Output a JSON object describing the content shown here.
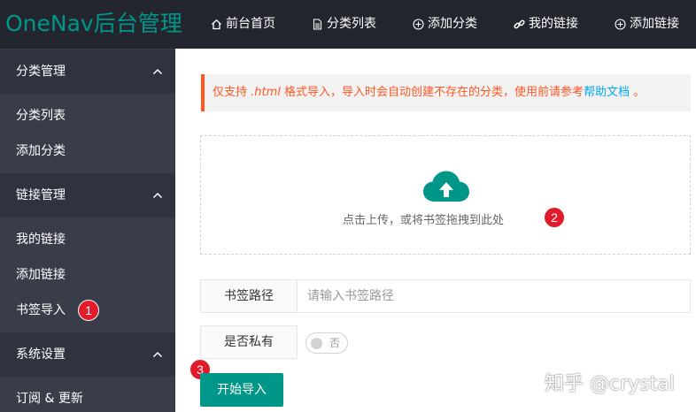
{
  "app": {
    "title": "OneNav后台管理"
  },
  "topnav": [
    {
      "label": "前台首页",
      "icon": "home-icon"
    },
    {
      "label": "分类列表",
      "icon": "document-icon"
    },
    {
      "label": "添加分类",
      "icon": "plus-circle-icon"
    },
    {
      "label": "我的链接",
      "icon": "link-icon"
    },
    {
      "label": "添加链接",
      "icon": "plus-circle-icon"
    }
  ],
  "sidebar": {
    "groups": [
      {
        "title": "分类管理",
        "items": [
          "分类列表",
          "添加分类"
        ]
      },
      {
        "title": "链接管理",
        "items": [
          "我的链接",
          "添加链接",
          "书签导入"
        ]
      },
      {
        "title": "系统设置",
        "items": [
          "订阅 & 更新"
        ]
      }
    ]
  },
  "tip": {
    "prefix": "仅支持",
    "format": ".html",
    "text": "格式导入，导入时会自动创建不存在的分类，使用前请参考",
    "link": "帮助文档",
    "suffix": "。"
  },
  "upload": {
    "hint": "点击上传，或将书签拖拽到此处"
  },
  "form": {
    "path_label": "书签路径",
    "path_placeholder": "请输入书签路径",
    "path_value": "",
    "private_label": "是否私有",
    "private_switch_text": "否",
    "private_on": false
  },
  "import_button": "开始导入",
  "annotations": [
    "1",
    "2",
    "3"
  ],
  "watermark": "知乎 @crystal",
  "colors": {
    "accent": "#009688",
    "topbar": "#23262e",
    "sidebar": "#393d49",
    "sidebar_group": "#2f3340",
    "warning": "#ff5722",
    "link": "#01aaed",
    "badge": "#e21b2b"
  }
}
